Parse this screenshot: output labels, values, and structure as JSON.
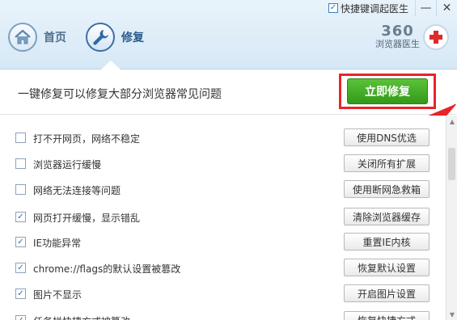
{
  "topbar": {
    "quick_launch_label": "快捷键调起医生",
    "quick_launch_checked": true,
    "minimize_glyph": "—",
    "close_glyph": "✕"
  },
  "nav": {
    "home_label": "首页",
    "repair_label": "修复"
  },
  "brand": {
    "number": "360",
    "name": "浏览器医生"
  },
  "action": {
    "title": "一键修复可以修复大部分浏览器常见问题",
    "button_label": "立即修复"
  },
  "issues": [
    {
      "label": "打不开网页，网络不稳定",
      "checked": false,
      "button": "使用DNS优选"
    },
    {
      "label": "浏览器运行缓慢",
      "checked": false,
      "button": "关闭所有扩展"
    },
    {
      "label": "网络无法连接等问题",
      "checked": false,
      "button": "使用断网急救箱"
    },
    {
      "label": "网页打开缓慢，显示错乱",
      "checked": true,
      "button": "清除浏览器缓存"
    },
    {
      "label": "IE功能异常",
      "checked": true,
      "button": "重置IE内核"
    },
    {
      "label": "chrome://flags的默认设置被篡改",
      "checked": true,
      "button": "恢复默认设置"
    },
    {
      "label": "图片不显示",
      "checked": true,
      "button": "开启图片设置"
    },
    {
      "label": "任务栏快捷方式被篡改",
      "checked": true,
      "button": "恢复快捷方式"
    }
  ],
  "colors": {
    "accent_red": "#e8242b",
    "action_green": "#3aa51f",
    "header_blue": "#d6e8f6"
  }
}
